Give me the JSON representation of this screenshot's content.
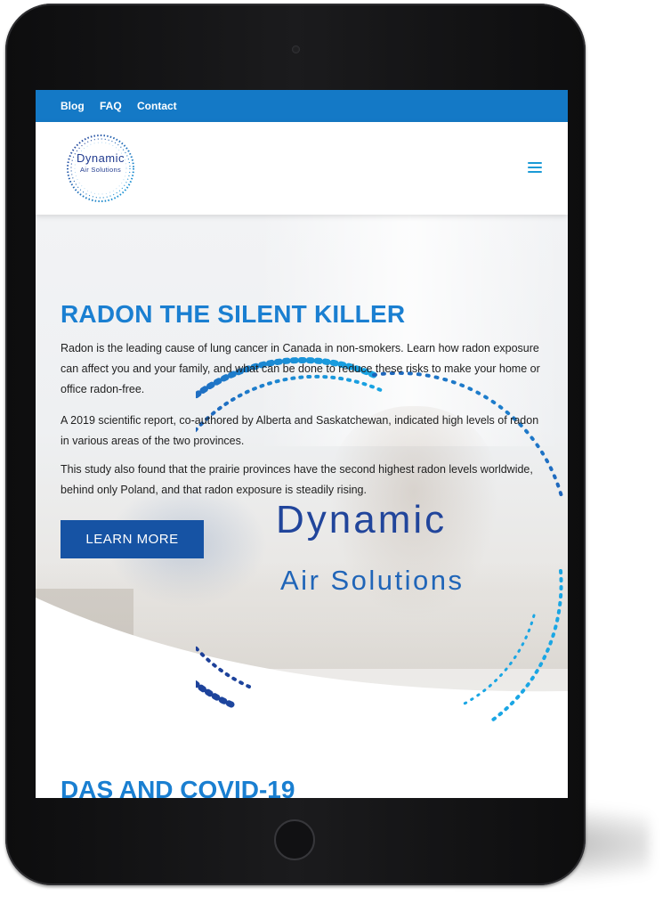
{
  "topbar": {
    "links": [
      "Blog",
      "FAQ",
      "Contact"
    ]
  },
  "logo": {
    "line1": "Dynamic",
    "line2": "Air Solutions"
  },
  "hero": {
    "title": "RADON THE SILENT KILLER",
    "paragraphs": [
      "Radon is the leading cause of lung cancer in Canada in non-smokers. Learn how radon exposure can affect you and your family, and what can be done to reduce these risks to make your home or office radon-free.",
      "A 2019 scientific report, co-authored by Alberta and Saskatchewan, indicated high levels of radon in various areas of the two provinces.",
      "This study also found that the prairie provinces have the second highest radon levels worldwide, behind only Poland, and that radon exposure is steadily rising."
    ],
    "cta_label": "LEARN MORE",
    "brand_line1": "Dynamic",
    "brand_line2": "Air Solutions"
  },
  "next_section": {
    "title": "DAS AND COVID-19"
  },
  "colors": {
    "topbar": "#1479c6",
    "heading": "#1a7fd1",
    "button": "#1653a4",
    "brand_dark": "#21459b"
  }
}
